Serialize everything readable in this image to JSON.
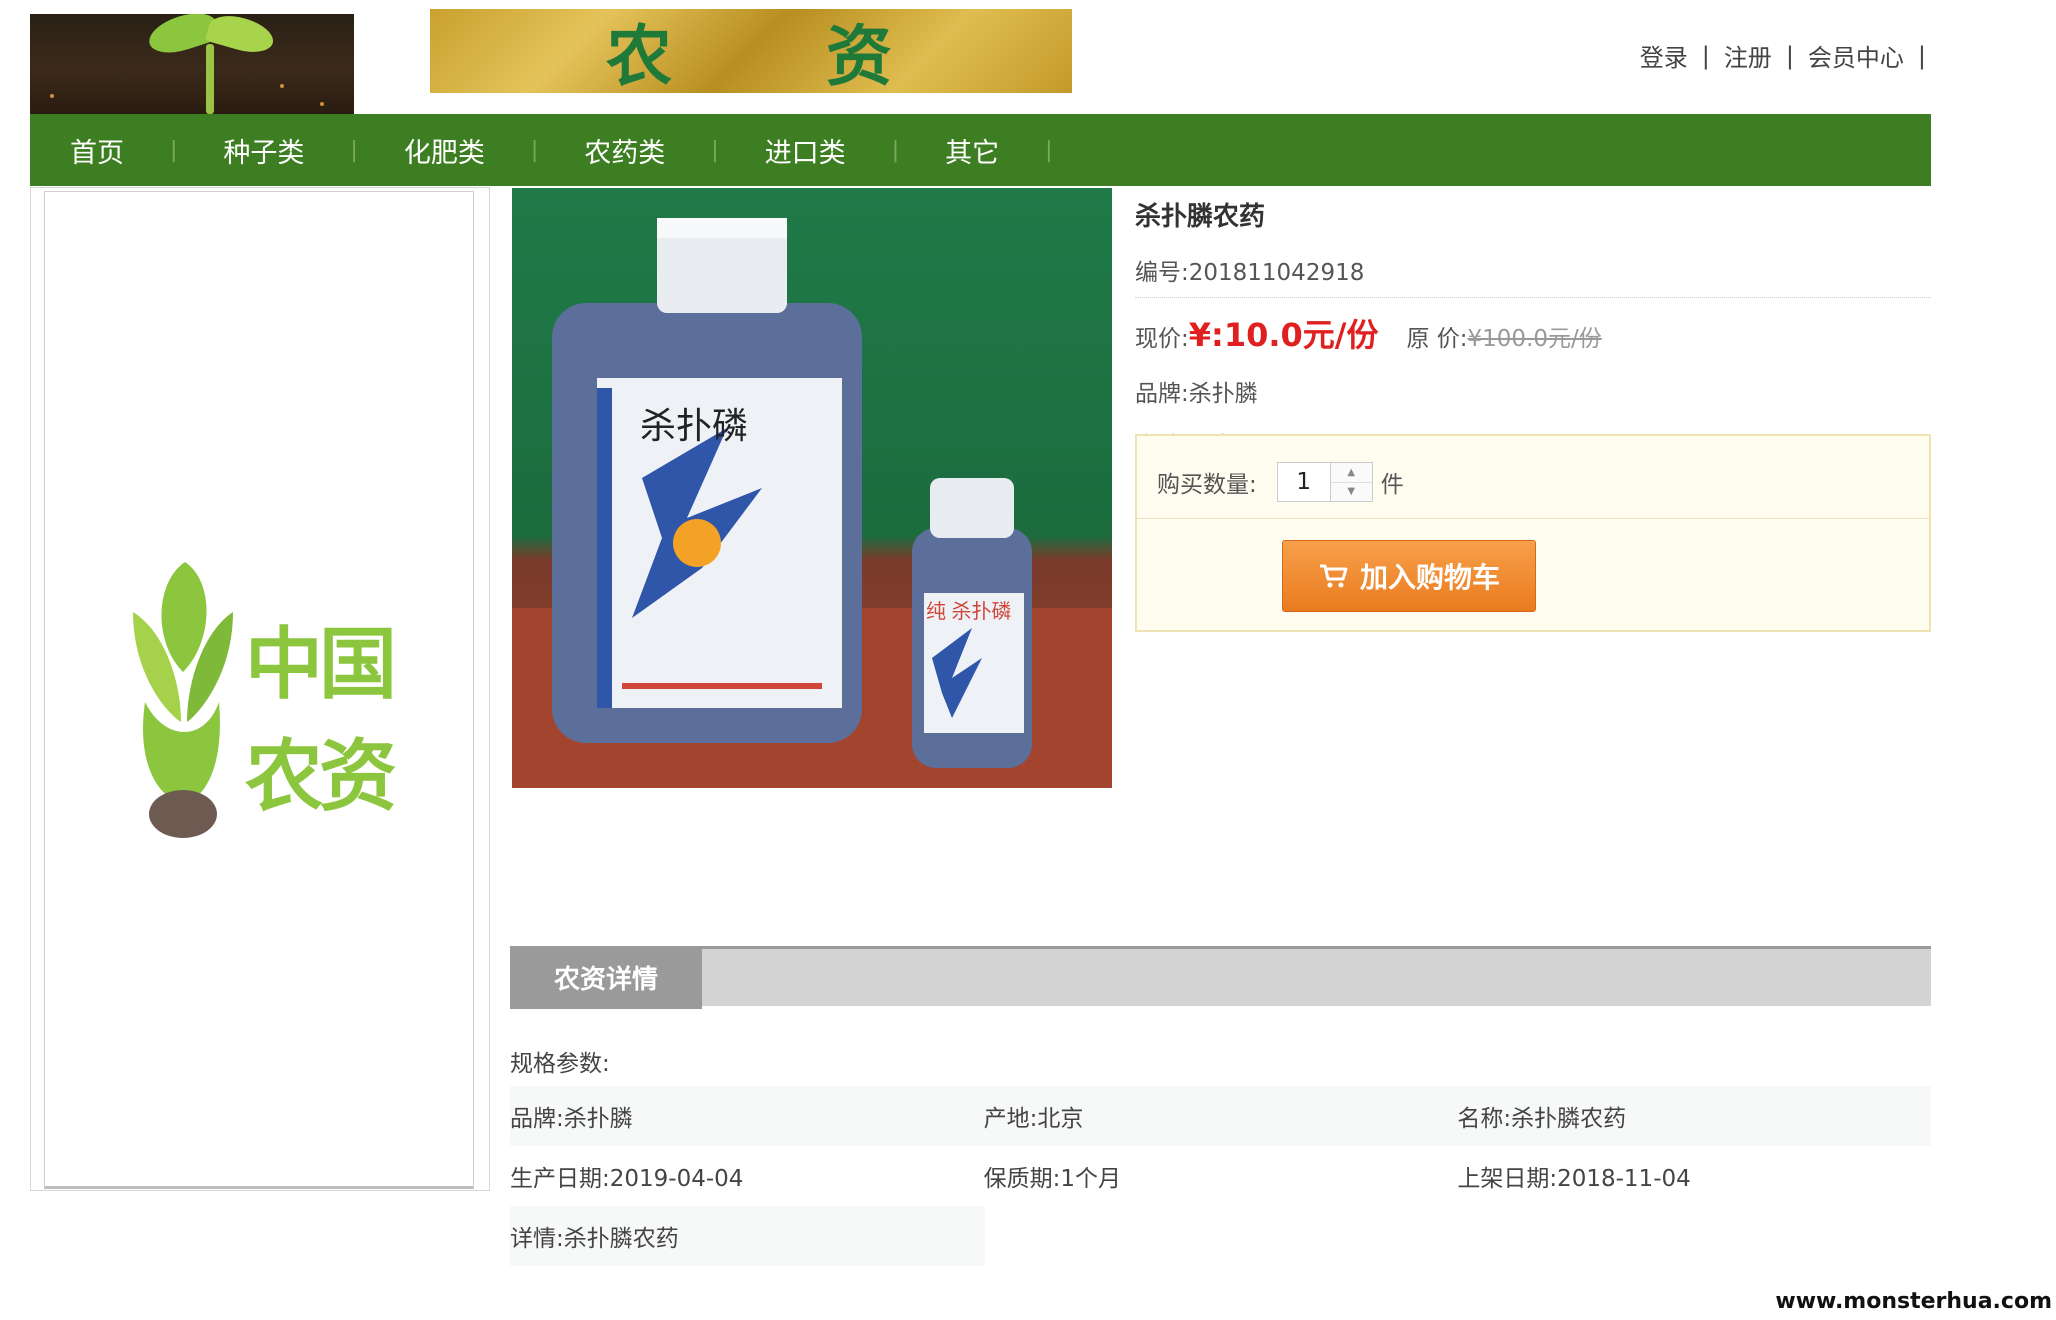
{
  "header": {
    "banner_text_1": "农",
    "banner_text_2": "资",
    "links": [
      "登录",
      "注册",
      "会员中心"
    ],
    "separator": "|"
  },
  "nav": {
    "items": [
      "首页",
      "种子类",
      "化肥类",
      "农药类",
      "进口类",
      "其它"
    ],
    "separator": "|"
  },
  "sidebar": {
    "brand_text": "中国农资"
  },
  "product": {
    "title": "杀扑膦农药",
    "code": "编号:201811042918",
    "price_label": "现价:",
    "price": "¥:10.0元/份",
    "orig_label": "原 价:",
    "orig_price": "¥100.0元/份",
    "brand": "品牌:杀扑膦",
    "origin": "产地:北京",
    "image_label_main": "杀扑磷",
    "image_label_small": "纯 杀扑磷"
  },
  "buy": {
    "qty_label": "购买数量:",
    "qty_value": "1",
    "unit": "件",
    "cart_button": "加入购物车"
  },
  "details": {
    "tab": "农资详情",
    "spec_label": "规格参数:",
    "rows": [
      [
        "品牌:杀扑膦",
        "产地:北京",
        "名称:杀扑膦农药"
      ],
      [
        "生产日期:2019-04-04",
        "保质期:1个月",
        "上架日期:2018-11-04"
      ],
      [
        "详情:杀扑膦农药"
      ]
    ]
  },
  "watermark": "www.monsterhua.com",
  "colors": {
    "nav_bg": "#3e7e22",
    "price": "#e02020",
    "cart_button": "#ea7b1f",
    "details_tab": "#9a9a9a"
  }
}
